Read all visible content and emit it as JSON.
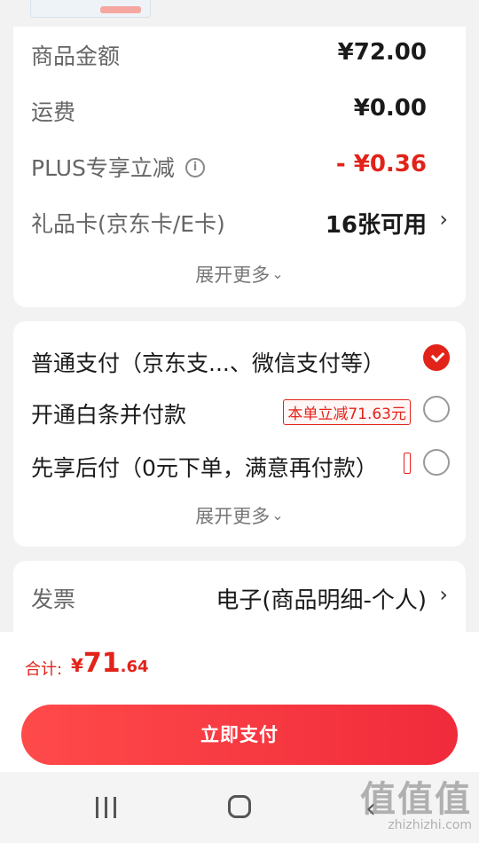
{
  "amount_card": {
    "rows": [
      {
        "label": "商品金额",
        "value": "¥72.00"
      },
      {
        "label": "运费",
        "value": "¥0.00"
      },
      {
        "label": "PLUS专享立减",
        "value": "- ¥0.36"
      },
      {
        "label": "礼品卡(京东卡/E卡)",
        "value": "16张可用"
      }
    ],
    "expand_label": "展开更多"
  },
  "payment_card": {
    "options": [
      {
        "label": "普通支付（京东支...、微信支付等）",
        "selected": true
      },
      {
        "label": "开通白条并付款",
        "badge": "本单立减71.63元",
        "selected": false
      },
      {
        "label": "先享后付（0元下单，满意再付款）",
        "selected": false
      }
    ],
    "expand_label": "展开更多"
  },
  "invoice": {
    "label": "发票",
    "value": "电子(商品明细-个人)"
  },
  "footer": {
    "total_label": "合计:",
    "total_currency": "¥",
    "total_int": "71",
    "total_dec": ".64",
    "pay_button": "立即支付"
  },
  "watermark": {
    "main": "值值值",
    "sub": "zhizhizhi.com"
  },
  "colors": {
    "accent": "#e2231a",
    "button": "#f02b3b"
  }
}
